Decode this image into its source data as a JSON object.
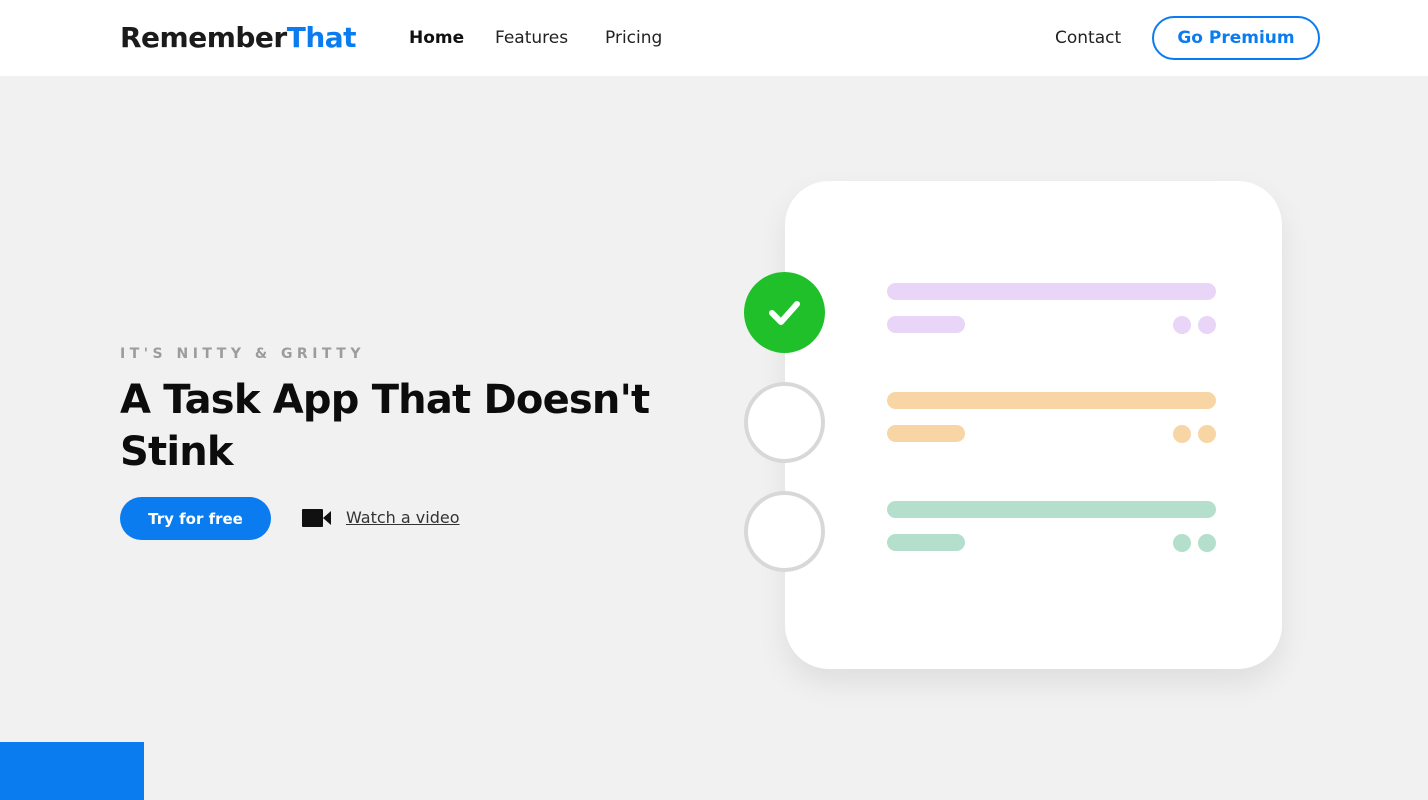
{
  "brand": {
    "name_part1": "Remember",
    "name_part2": "That"
  },
  "nav": {
    "home": "Home",
    "features": "Features",
    "pricing": "Pricing",
    "contact": "Contact",
    "premium_button": "Go Premium"
  },
  "hero": {
    "eyebrow": "IT'S NITTY & GRITTY",
    "headline": "A Task App That Doesn't Stink",
    "primary_button": "Try for free",
    "video_link": "Watch a video"
  },
  "illustration": {
    "tasks": [
      {
        "status": "done",
        "color": "#e8d5f7"
      },
      {
        "status": "todo",
        "color": "#f8d5a5"
      },
      {
        "status": "todo",
        "color": "#b3dfcc"
      }
    ]
  },
  "colors": {
    "accent": "#0a7cf0",
    "check_green": "#1fc02a",
    "background": "#f1f1f1"
  },
  "icons": [
    "check-icon",
    "video-camera-icon"
  ]
}
